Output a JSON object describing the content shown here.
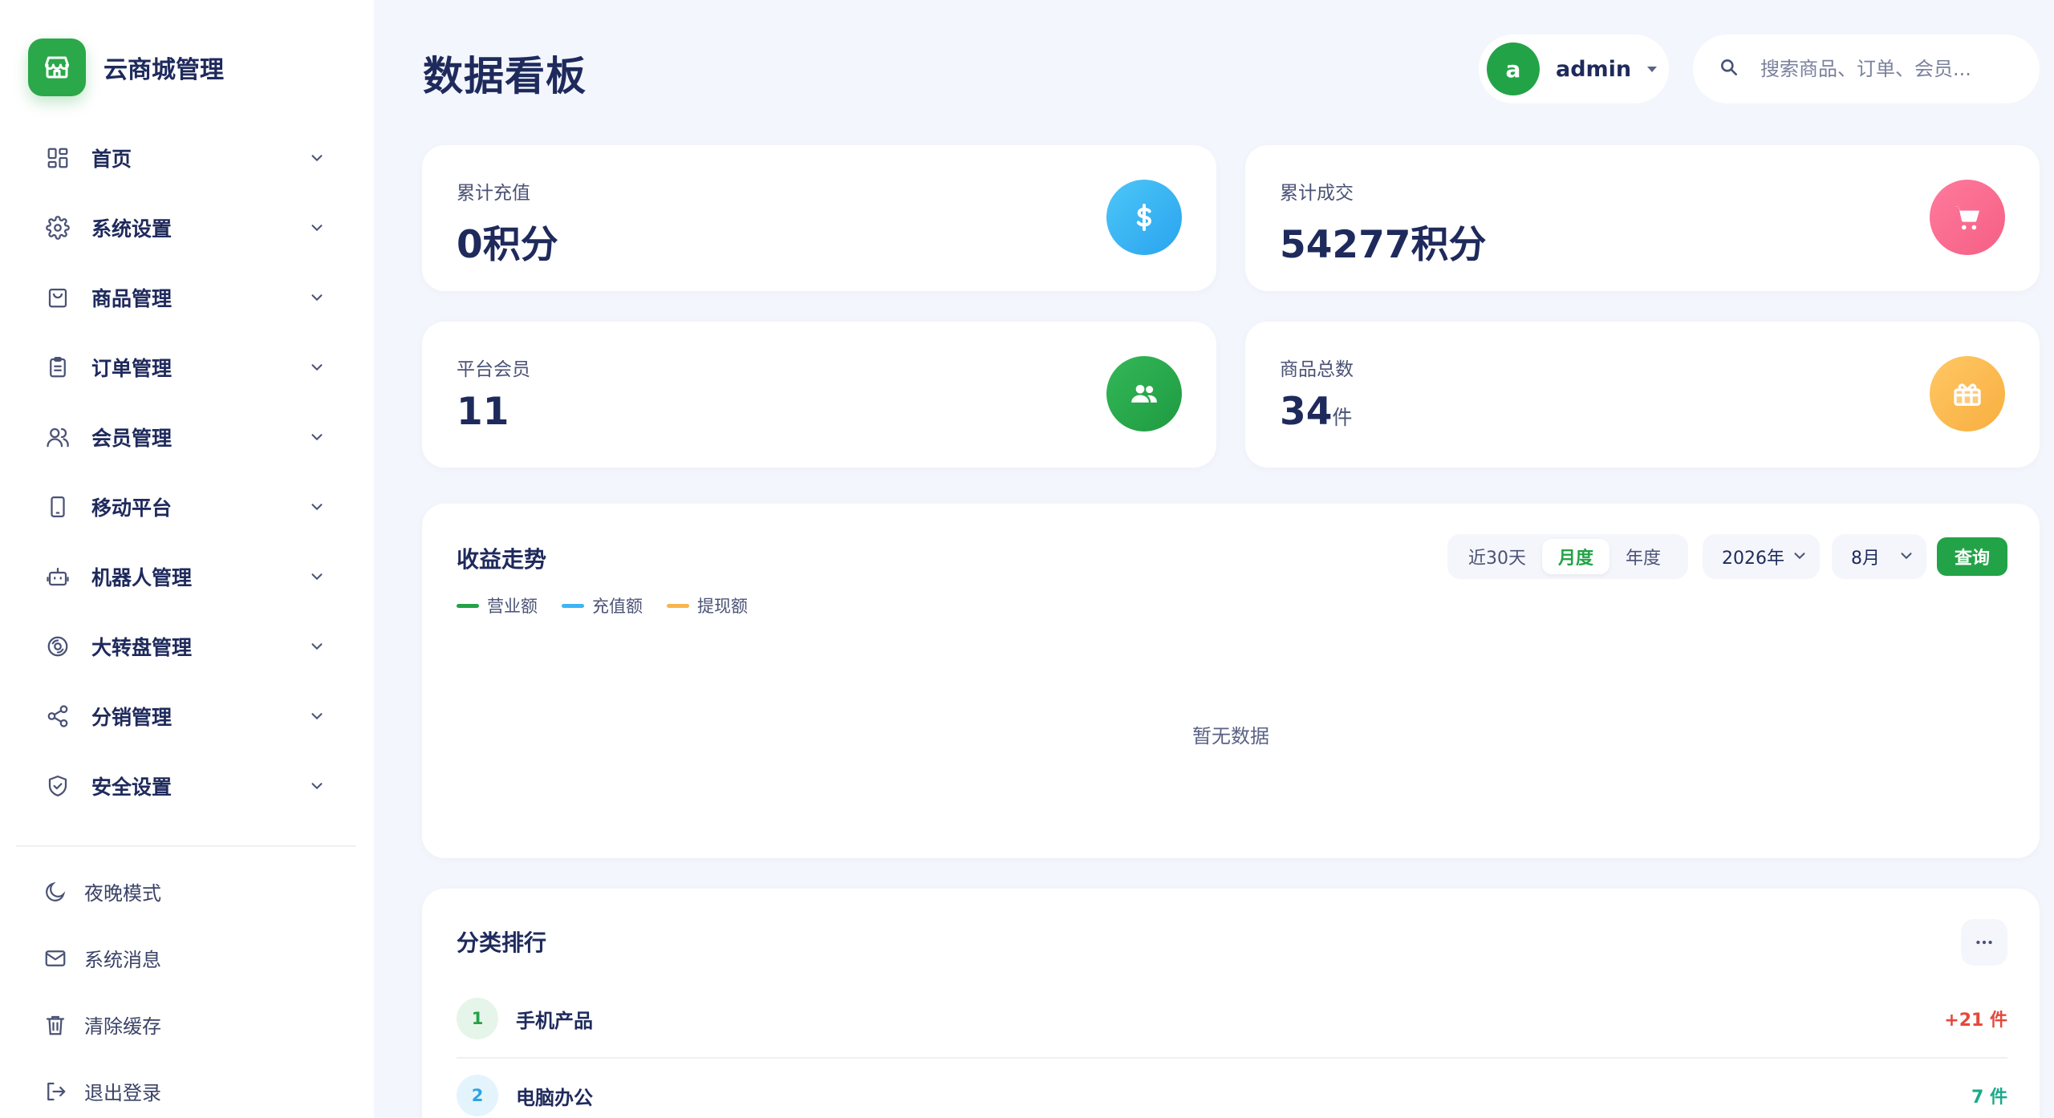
{
  "brand": {
    "name": "云商城管理",
    "icon": "store-icon",
    "color": "#2aa84a"
  },
  "nav": [
    {
      "label": "首页",
      "icon": "dashboard-grid-icon"
    },
    {
      "label": "系统设置",
      "icon": "gear-icon"
    },
    {
      "label": "商品管理",
      "icon": "shopping-bag-icon"
    },
    {
      "label": "订单管理",
      "icon": "clipboard-icon"
    },
    {
      "label": "会员管理",
      "icon": "users-icon"
    },
    {
      "label": "移动平台",
      "icon": "mobile-icon"
    },
    {
      "label": "机器人管理",
      "icon": "robot-icon"
    },
    {
      "label": "大转盘管理",
      "icon": "wheel-icon"
    },
    {
      "label": "分销管理",
      "icon": "share-icon"
    },
    {
      "label": "安全设置",
      "icon": "shield-icon"
    }
  ],
  "utilities": [
    {
      "label": "夜晚模式",
      "icon": "moon-icon"
    },
    {
      "label": "系统消息",
      "icon": "mail-icon"
    },
    {
      "label": "清除缓存",
      "icon": "trash-icon"
    },
    {
      "label": "退出登录",
      "icon": "logout-icon"
    }
  ],
  "header": {
    "title": "数据看板",
    "user": {
      "avatar_letter": "a",
      "name": "admin"
    },
    "search_placeholder": "搜索商品、订单、会员..."
  },
  "stats": [
    {
      "label": "累计充值",
      "value": "0积分",
      "unit": "",
      "icon": "dollar-icon",
      "color": "#3cb5f5"
    },
    {
      "label": "累计成交",
      "value": "54277积分",
      "unit": "",
      "icon": "cart-icon",
      "color": "#fb6d92"
    },
    {
      "label": "平台会员",
      "value": "11",
      "unit": "",
      "icon": "members-icon",
      "color": "#27a84a"
    },
    {
      "label": "商品总数",
      "value": "34",
      "unit": "件",
      "icon": "gift-box-icon",
      "color": "#fbbd52"
    }
  ],
  "trend": {
    "title": "收益走势",
    "legend": [
      {
        "label": "营业额",
        "color": "#23a347"
      },
      {
        "label": "充值额",
        "color": "#3cb5f5"
      },
      {
        "label": "提现额",
        "color": "#f7b64d"
      }
    ],
    "ranges": [
      "近30天",
      "月度",
      "年度"
    ],
    "active_range": "月度",
    "year": "2026年",
    "month": "8月",
    "query_label": "查询",
    "empty_text": "暂无数据"
  },
  "ranking": {
    "title": "分类排行",
    "items": [
      {
        "rank": "1",
        "name": "手机产品",
        "count": "+21 件",
        "count_color": "#e5483b",
        "badge_bg": "#e6f5ea",
        "badge_fg": "#23a347"
      },
      {
        "rank": "2",
        "name": "电脑办公",
        "count": "7 件",
        "count_color": "#1aaa8a",
        "badge_bg": "#e4f4fd",
        "badge_fg": "#2ea4e0"
      }
    ]
  }
}
